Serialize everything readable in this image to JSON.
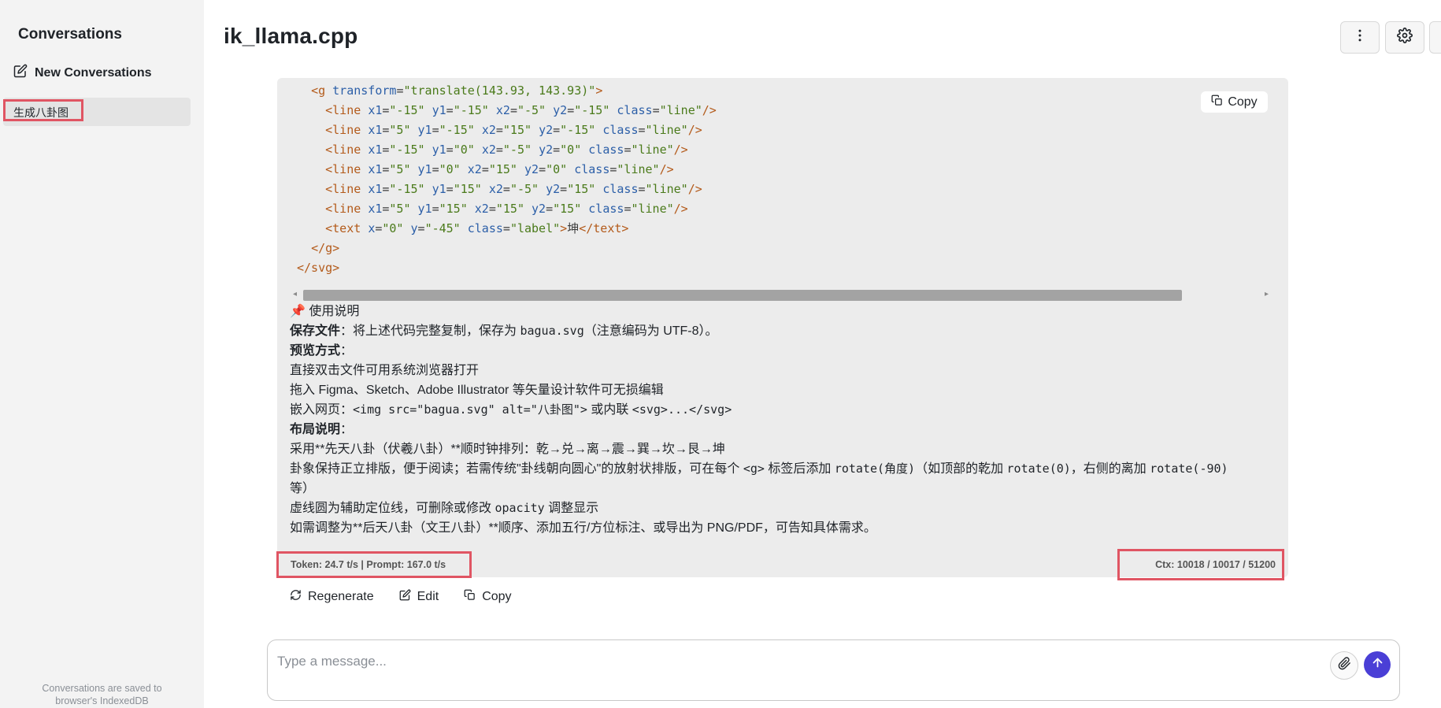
{
  "sidebar": {
    "title": "Conversations",
    "new_label": "New Conversations",
    "items": [
      {
        "label": "生成八卦图"
      }
    ],
    "footer_line1": "Conversations are saved to",
    "footer_line2": "browser's IndexedDB"
  },
  "header": {
    "title": "ik_llama.cpp",
    "buttons": [
      "more-vertical-icon",
      "gear-icon"
    ]
  },
  "code_block": {
    "copy_label": "Copy",
    "lines": [
      {
        "indent": "  ",
        "parts": [
          [
            "tag",
            "<g "
          ],
          [
            "attr",
            "transform"
          ],
          [
            "plain",
            "="
          ],
          [
            "val",
            "\"translate(143.93, 143.93)\""
          ],
          [
            "tag",
            ">"
          ]
        ]
      },
      {
        "indent": "    ",
        "parts": [
          [
            "tag",
            "<line "
          ],
          [
            "attr",
            "x1"
          ],
          [
            "plain",
            "="
          ],
          [
            "val",
            "\"-15\""
          ],
          [
            "plain",
            " "
          ],
          [
            "attr",
            "y1"
          ],
          [
            "plain",
            "="
          ],
          [
            "val",
            "\"-15\""
          ],
          [
            "plain",
            " "
          ],
          [
            "attr",
            "x2"
          ],
          [
            "plain",
            "="
          ],
          [
            "val",
            "\"-5\""
          ],
          [
            "plain",
            " "
          ],
          [
            "attr",
            "y2"
          ],
          [
            "plain",
            "="
          ],
          [
            "val",
            "\"-15\""
          ],
          [
            "plain",
            " "
          ],
          [
            "attr",
            "class"
          ],
          [
            "plain",
            "="
          ],
          [
            "val",
            "\"line\""
          ],
          [
            "tag",
            "/>"
          ]
        ]
      },
      {
        "indent": "    ",
        "parts": [
          [
            "tag",
            "<line "
          ],
          [
            "attr",
            "x1"
          ],
          [
            "plain",
            "="
          ],
          [
            "val",
            "\"5\""
          ],
          [
            "plain",
            " "
          ],
          [
            "attr",
            "y1"
          ],
          [
            "plain",
            "="
          ],
          [
            "val",
            "\"-15\""
          ],
          [
            "plain",
            " "
          ],
          [
            "attr",
            "x2"
          ],
          [
            "plain",
            "="
          ],
          [
            "val",
            "\"15\""
          ],
          [
            "plain",
            " "
          ],
          [
            "attr",
            "y2"
          ],
          [
            "plain",
            "="
          ],
          [
            "val",
            "\"-15\""
          ],
          [
            "plain",
            " "
          ],
          [
            "attr",
            "class"
          ],
          [
            "plain",
            "="
          ],
          [
            "val",
            "\"line\""
          ],
          [
            "tag",
            "/>"
          ]
        ]
      },
      {
        "indent": "    ",
        "parts": [
          [
            "tag",
            "<line "
          ],
          [
            "attr",
            "x1"
          ],
          [
            "plain",
            "="
          ],
          [
            "val",
            "\"-15\""
          ],
          [
            "plain",
            " "
          ],
          [
            "attr",
            "y1"
          ],
          [
            "plain",
            "="
          ],
          [
            "val",
            "\"0\""
          ],
          [
            "plain",
            " "
          ],
          [
            "attr",
            "x2"
          ],
          [
            "plain",
            "="
          ],
          [
            "val",
            "\"-5\""
          ],
          [
            "plain",
            " "
          ],
          [
            "attr",
            "y2"
          ],
          [
            "plain",
            "="
          ],
          [
            "val",
            "\"0\""
          ],
          [
            "plain",
            " "
          ],
          [
            "attr",
            "class"
          ],
          [
            "plain",
            "="
          ],
          [
            "val",
            "\"line\""
          ],
          [
            "tag",
            "/>"
          ]
        ]
      },
      {
        "indent": "    ",
        "parts": [
          [
            "tag",
            "<line "
          ],
          [
            "attr",
            "x1"
          ],
          [
            "plain",
            "="
          ],
          [
            "val",
            "\"5\""
          ],
          [
            "plain",
            " "
          ],
          [
            "attr",
            "y1"
          ],
          [
            "plain",
            "="
          ],
          [
            "val",
            "\"0\""
          ],
          [
            "plain",
            " "
          ],
          [
            "attr",
            "x2"
          ],
          [
            "plain",
            "="
          ],
          [
            "val",
            "\"15\""
          ],
          [
            "plain",
            " "
          ],
          [
            "attr",
            "y2"
          ],
          [
            "plain",
            "="
          ],
          [
            "val",
            "\"0\""
          ],
          [
            "plain",
            " "
          ],
          [
            "attr",
            "class"
          ],
          [
            "plain",
            "="
          ],
          [
            "val",
            "\"line\""
          ],
          [
            "tag",
            "/>"
          ]
        ]
      },
      {
        "indent": "    ",
        "parts": [
          [
            "tag",
            "<line "
          ],
          [
            "attr",
            "x1"
          ],
          [
            "plain",
            "="
          ],
          [
            "val",
            "\"-15\""
          ],
          [
            "plain",
            " "
          ],
          [
            "attr",
            "y1"
          ],
          [
            "plain",
            "="
          ],
          [
            "val",
            "\"15\""
          ],
          [
            "plain",
            " "
          ],
          [
            "attr",
            "x2"
          ],
          [
            "plain",
            "="
          ],
          [
            "val",
            "\"-5\""
          ],
          [
            "plain",
            " "
          ],
          [
            "attr",
            "y2"
          ],
          [
            "plain",
            "="
          ],
          [
            "val",
            "\"15\""
          ],
          [
            "plain",
            " "
          ],
          [
            "attr",
            "class"
          ],
          [
            "plain",
            "="
          ],
          [
            "val",
            "\"line\""
          ],
          [
            "tag",
            "/>"
          ]
        ]
      },
      {
        "indent": "    ",
        "parts": [
          [
            "tag",
            "<line "
          ],
          [
            "attr",
            "x1"
          ],
          [
            "plain",
            "="
          ],
          [
            "val",
            "\"5\""
          ],
          [
            "plain",
            " "
          ],
          [
            "attr",
            "y1"
          ],
          [
            "plain",
            "="
          ],
          [
            "val",
            "\"15\""
          ],
          [
            "plain",
            " "
          ],
          [
            "attr",
            "x2"
          ],
          [
            "plain",
            "="
          ],
          [
            "val",
            "\"15\""
          ],
          [
            "plain",
            " "
          ],
          [
            "attr",
            "y2"
          ],
          [
            "plain",
            "="
          ],
          [
            "val",
            "\"15\""
          ],
          [
            "plain",
            " "
          ],
          [
            "attr",
            "class"
          ],
          [
            "plain",
            "="
          ],
          [
            "val",
            "\"line\""
          ],
          [
            "tag",
            "/>"
          ]
        ]
      },
      {
        "indent": "    ",
        "parts": [
          [
            "tag",
            "<text "
          ],
          [
            "attr",
            "x"
          ],
          [
            "plain",
            "="
          ],
          [
            "val",
            "\"0\""
          ],
          [
            "plain",
            " "
          ],
          [
            "attr",
            "y"
          ],
          [
            "plain",
            "="
          ],
          [
            "val",
            "\"-45\""
          ],
          [
            "plain",
            " "
          ],
          [
            "attr",
            "class"
          ],
          [
            "plain",
            "="
          ],
          [
            "val",
            "\"label\""
          ],
          [
            "tag",
            ">"
          ],
          [
            "plain",
            "坤"
          ],
          [
            "tag",
            "</text>"
          ]
        ]
      },
      {
        "indent": "  ",
        "parts": [
          [
            "tag",
            "</g>"
          ]
        ]
      },
      {
        "indent": "",
        "parts": [
          [
            "tag",
            "</svg>"
          ]
        ]
      }
    ]
  },
  "explanation": {
    "heading": "使用说明",
    "save_label": "保存文件",
    "save_text_pre": "：将上述代码完整复制，保存为 ",
    "save_code": "bagua.svg",
    "save_text_post": "（注意编码为 UTF-8）。",
    "preview_label": "预览方式",
    "preview_colon": "：",
    "preview_line1": "直接双击文件可用系统浏览器打开",
    "preview_line2": "拖入 Figma、Sketch、Adobe Illustrator 等矢量设计软件可无损编辑",
    "embed_pre": "嵌入网页：",
    "embed_code1": "<img src=\"bagua.svg\" alt=\"八卦图\">",
    "embed_mid": " 或内联 ",
    "embed_code2": "<svg>...</svg>",
    "layout_label": "布局说明",
    "layout_colon": "：",
    "layout_line1": "采用**先天八卦（伏羲八卦）**顺时钟排列：乾→兑→离→震→巽→坎→艮→坤",
    "layout_line2_a": "卦象保持正立排版，便于阅读；若需传统\"卦线朝向圆心\"的放射状排版，可在每个 ",
    "layout_line2_code1": "<g>",
    "layout_line2_b": " 标签后添加 ",
    "layout_line2_code2": "rotate(角度)",
    "layout_line2_c": "（如顶部的乾加 ",
    "layout_line2_code3": "rotate(0)",
    "layout_line2_d": "，右侧的离加 ",
    "layout_line2_code4": "rotate(-90)",
    "layout_line2_e": "等）",
    "layout_line3_a": "虚线圆为辅助定位线，可删除或修改 ",
    "layout_line3_code": "opacity",
    "layout_line3_b": " 调整显示",
    "layout_line4": "如需调整为**后天八卦（文王八卦）**顺序、添加五行/方位标注、或导出为 PNG/PDF，可告知具体需求。"
  },
  "stats": {
    "token": "Token: 24.7 t/s | Prompt: 167.0 t/s",
    "ctx": "Ctx: 10018 / 10017 / 51200"
  },
  "actions": {
    "regenerate": "Regenerate",
    "edit": "Edit",
    "copy": "Copy"
  },
  "composer": {
    "placeholder": "Type a message..."
  },
  "colors": {
    "accent": "#4a3fd6",
    "highlight_box": "#e05563",
    "card_bg": "#ececec",
    "sidebar_bg": "#f3f3f3"
  }
}
